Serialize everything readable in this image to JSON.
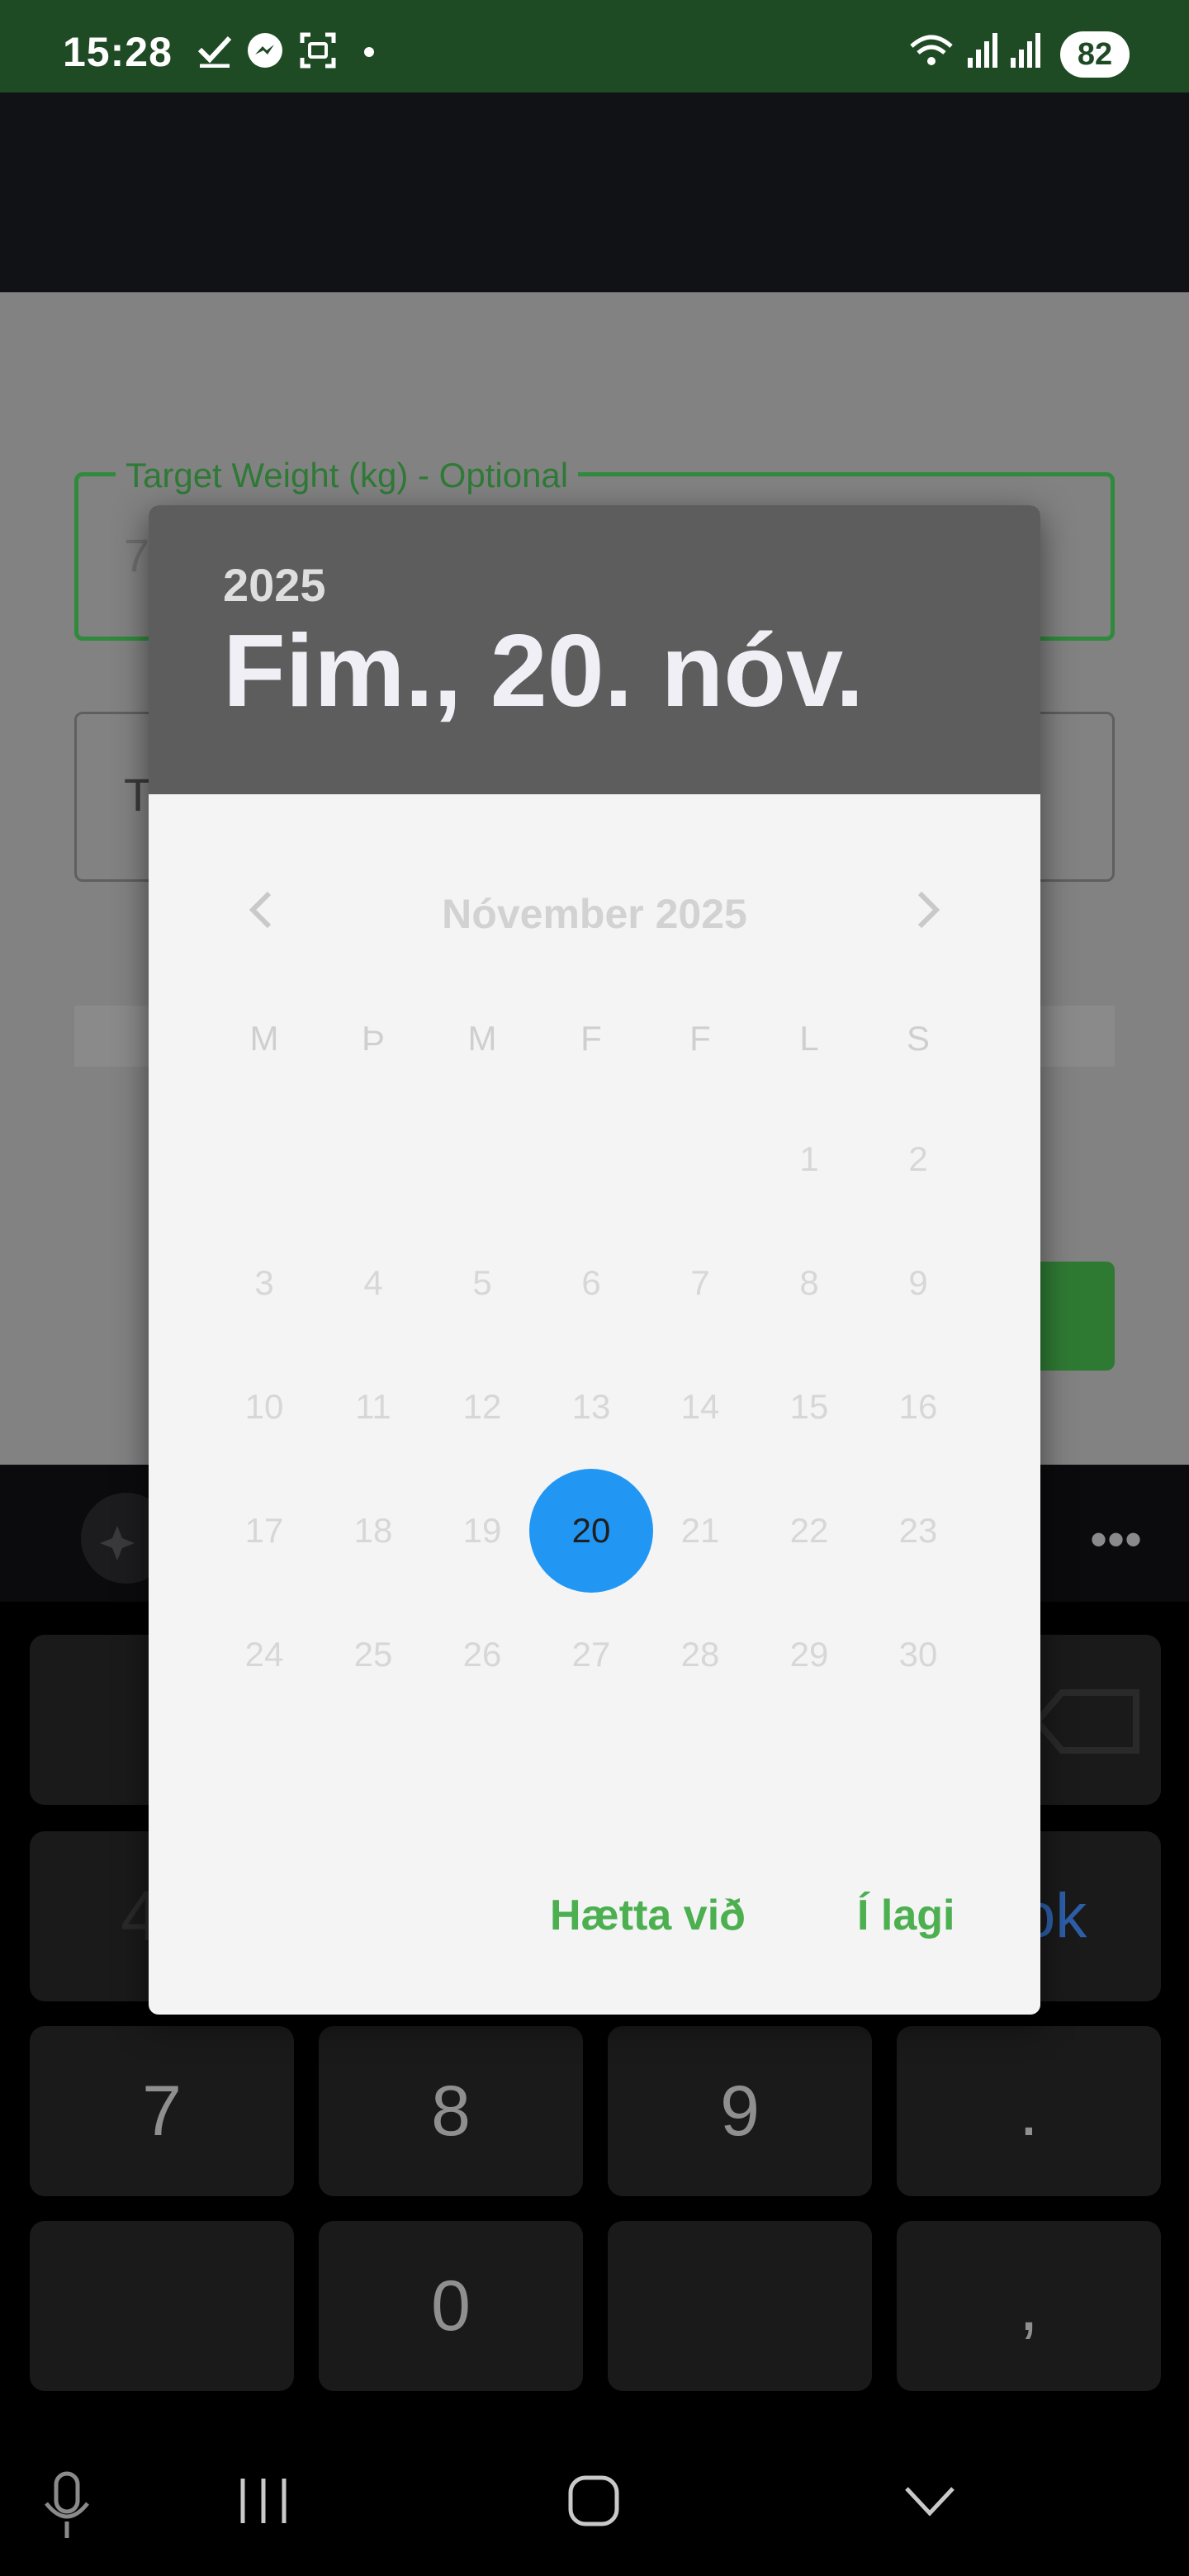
{
  "status_bar": {
    "time": "15:28",
    "battery": "82",
    "icons": [
      "check-icon",
      "messenger-icon",
      "screenshot-icon",
      "dot-icon",
      "wifi-icon",
      "signal-icon",
      "signal-roaming-icon"
    ]
  },
  "app": {
    "target_weight_label": "Target Weight (kg) - Optional",
    "target_weight_value_partial": "7",
    "second_field_partial": "T"
  },
  "date_picker": {
    "year": "2025",
    "selected_date": "Fim., 20. nóv.",
    "month_title": "Nóvember 2025",
    "weekdays": [
      "M",
      "Þ",
      "M",
      "F",
      "F",
      "L",
      "S"
    ],
    "weeks": [
      [
        "",
        "",
        "",
        "",
        "",
        "1",
        "2"
      ],
      [
        "3",
        "4",
        "5",
        "6",
        "7",
        "8",
        "9"
      ],
      [
        "10",
        "11",
        "12",
        "13",
        "14",
        "15",
        "16"
      ],
      [
        "17",
        "18",
        "19",
        "20",
        "21",
        "22",
        "23"
      ],
      [
        "24",
        "25",
        "26",
        "27",
        "28",
        "29",
        "30"
      ]
    ],
    "selected_day": "20",
    "selected_color": "#2196f3",
    "cancel_label": "Hætta við",
    "ok_label": "Í lagi",
    "button_color": "#4caf50"
  },
  "keyboard": {
    "keys": [
      "7",
      "8",
      "9",
      ".",
      "0",
      ","
    ],
    "partial_right_key": "ok",
    "partial_left_key": "4"
  }
}
